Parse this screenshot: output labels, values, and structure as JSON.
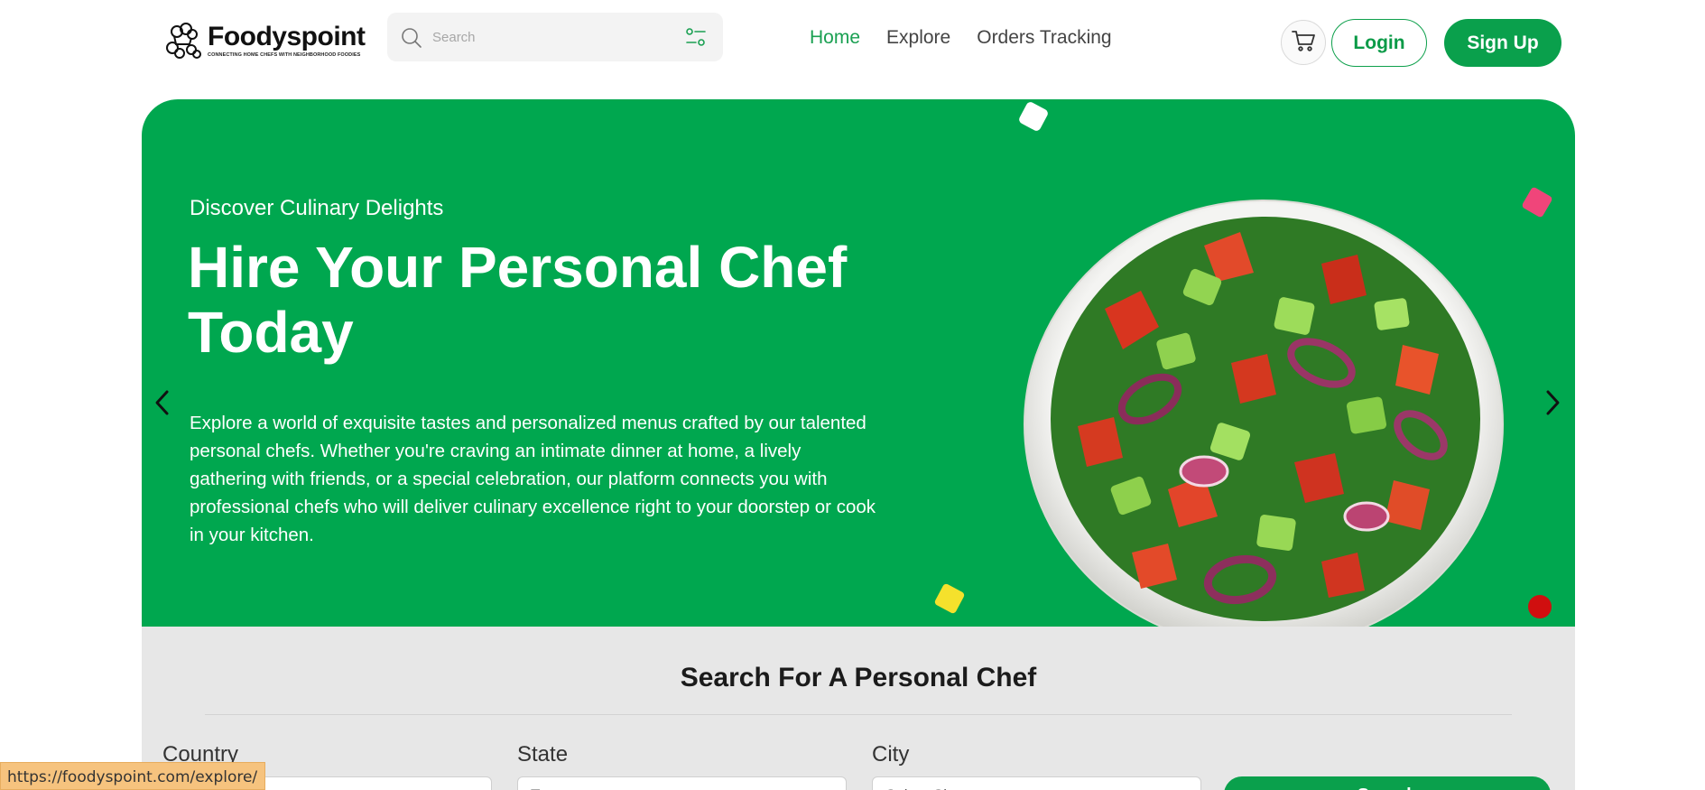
{
  "header": {
    "logo": {
      "name": "Foodyspoint",
      "tagline": "CONNECTING HOME CHEFS WITH NEIGHBORHOOD FOODIES"
    },
    "search": {
      "placeholder": "Search",
      "value": ""
    },
    "nav": [
      {
        "label": "Home",
        "active": true
      },
      {
        "label": "Explore",
        "active": false
      },
      {
        "label": "Orders Tracking",
        "active": false
      }
    ],
    "login_label": "Login",
    "signup_label": "Sign Up",
    "icons": {
      "search": "search-icon",
      "filter": "filter-icon",
      "cart": "cart-icon"
    }
  },
  "hero": {
    "eyebrow": "Discover Culinary Delights",
    "title": "Hire Your Personal Chef Today",
    "description": "Explore a world of exquisite tastes and personalized menus crafted by our talented personal chefs. Whether you're craving an intimate dinner at home, a lively gathering with friends, or a special celebration, our platform connects you with professional chefs who will deliver culinary excellence right to your doorstep or cook in your kitchen.",
    "image": "salad-bowl",
    "icons": {
      "prev": "chevron-left-icon",
      "next": "chevron-right-icon"
    }
  },
  "search_section": {
    "title": "Search For A Personal Chef",
    "fields": [
      {
        "label": "Country",
        "value": ""
      },
      {
        "label": "State",
        "value": "Te"
      },
      {
        "label": "City",
        "value": "Select City"
      }
    ],
    "submit_label": "Search"
  },
  "status_bar": {
    "url": "https://foodyspoint.com/explore/"
  },
  "colors": {
    "brand_green": "#00a74f",
    "button_green": "#0aa04c",
    "nav_active": "#1aa052",
    "section_bg": "#e7e7e7",
    "confetti": [
      "#ffffff",
      "#f0457a",
      "#f5e12c",
      "#d00f0f"
    ]
  }
}
